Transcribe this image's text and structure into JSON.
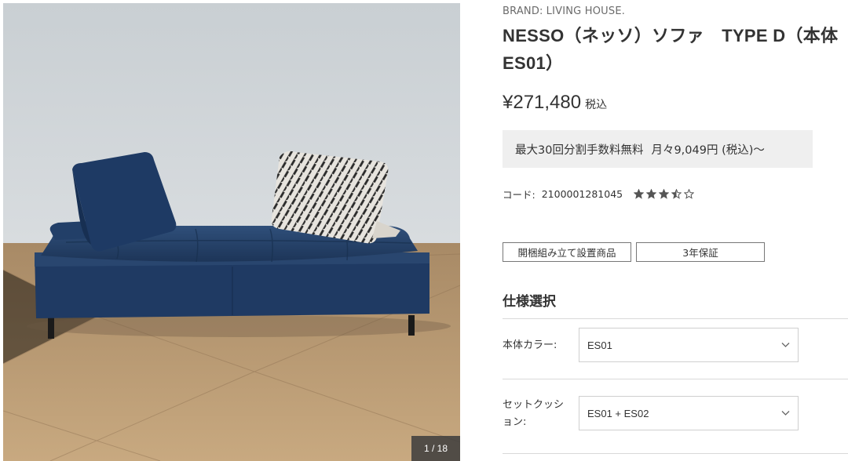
{
  "product": {
    "brand_label": "BRAND:",
    "brand_name": "LIVING HOUSE.",
    "title": "NESSO（ネッソ）ソファ　TYPE D（本体ES01）",
    "price": "¥271,480",
    "tax_label": "税込",
    "installment_text": "最大30回分割手数料無料",
    "monthly_text": "月々9,049円 (税込)～",
    "code_label": "コード:",
    "code_value": "2100001281045",
    "rating": 3.5,
    "rating_max": 5,
    "tags": [
      "開梱組み立て設置商品",
      "3年保証"
    ]
  },
  "gallery": {
    "counter": "1 / 18",
    "current": 1,
    "total": 18
  },
  "spec": {
    "heading": "仕様選択",
    "options": [
      {
        "label": "本体カラー:",
        "value": "ES01"
      },
      {
        "label": "セットクッション:",
        "value": "ES01 + ES02"
      }
    ]
  },
  "colors": {
    "sofa": "#1f3a63",
    "background": "#ffffff",
    "installment_bg": "#efefef",
    "text": "#333333",
    "star": "#555555"
  }
}
